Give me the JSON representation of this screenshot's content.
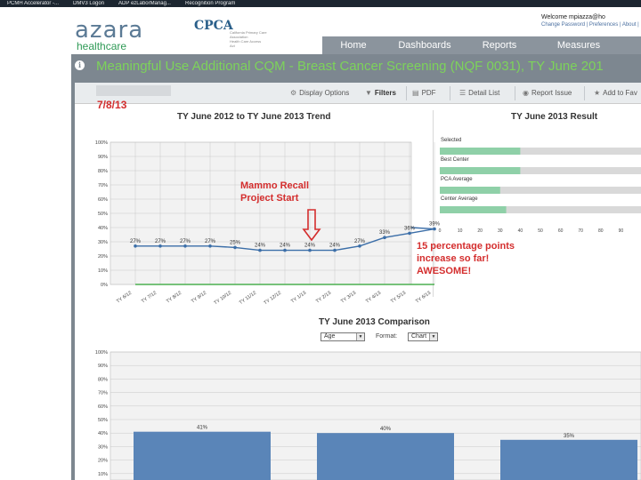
{
  "browser": {
    "tabs": [
      "PCMH Accelerator -...",
      "DMV3 Logon",
      "ADP ezLaborManag...",
      "Recognition Program"
    ]
  },
  "header": {
    "logo_main": "azara",
    "logo_sub": "healthcare",
    "partner_logo": "CPCA",
    "partner_sub": "California Primary Care Association",
    "partner_sub2": "Health Care Access Act",
    "welcome": "Welcome mpiazza@ho",
    "links": "Change Password | Preferences | About |"
  },
  "nav": {
    "items": [
      {
        "label": "Home"
      },
      {
        "label": "Dashboards"
      },
      {
        "label": "Reports"
      },
      {
        "label": "Measures"
      }
    ]
  },
  "page": {
    "title": "Meaningful Use Additional CQM - Breast Cancer Screening (NQF 0031), TY June 201"
  },
  "toolbar": {
    "display_options": "Display Options",
    "filters": "Filters",
    "pdf": "PDF",
    "detail_list": "Detail List",
    "report_issue": "Report Issue",
    "add_to_fav": "Add to Fav"
  },
  "annotations": {
    "date": "7/8/13",
    "mammo_line1": "Mammo Recall",
    "mammo_line2": "Project Start",
    "increase_line1": "15 percentage points",
    "increase_line2": "increase so far!",
    "increase_line3": "AWESOME!"
  },
  "result_panel": {
    "title": "TY June 2013 Result",
    "rows": [
      {
        "label": "Selected",
        "value": 40
      },
      {
        "label": "Best Center",
        "value": 40
      },
      {
        "label": "PCA Average",
        "value": 30
      },
      {
        "label": "Center Average",
        "value": 33
      }
    ],
    "ticks": [
      "0",
      "10",
      "20",
      "30",
      "40",
      "50",
      "60",
      "70",
      "80",
      "90"
    ],
    "colors": {
      "bar": "#8fd0a8",
      "track": "#d9d9d9"
    }
  },
  "comparison": {
    "title": "TY June 2013 Comparison",
    "group_by": "Age",
    "format_label": "Format:",
    "format_value": "Chart"
  },
  "chart_data": [
    {
      "type": "line",
      "title": "TY June 2012 to TY June 2013 Trend",
      "categories": [
        "TY 6/12",
        "TY 7/12",
        "TY 8/12",
        "TY 9/12",
        "TY 10/12",
        "TY 11/12",
        "TY 12/12",
        "TY 1/13",
        "TY 2/13",
        "TY 3/13",
        "TY 4/13",
        "TY 5/13",
        "TY 6/13"
      ],
      "series": [
        {
          "values": [
            27,
            27,
            27,
            27,
            26,
            24,
            24,
            24,
            24,
            27,
            33,
            36,
            39
          ],
          "labels": [
            "27%",
            "27%",
            "27%",
            "27%",
            "25%",
            "24%",
            "24%",
            "24%",
            "24%",
            "27%",
            "33%",
            "36%",
            "39%"
          ],
          "color": "#3b6ea8"
        },
        {
          "values": [
            0,
            0,
            0,
            0,
            0,
            0,
            0,
            0,
            0,
            0,
            0,
            0,
            0
          ],
          "color": "#4caf50"
        }
      ],
      "ylim": [
        0,
        100
      ],
      "yticks": [
        "0%",
        "10%",
        "20%",
        "30%",
        "40%",
        "50%",
        "60%",
        "70%",
        "80%",
        "90%",
        "100%"
      ],
      "grid": true
    },
    {
      "type": "bar",
      "title": "TY June 2013 Comparison",
      "categories": [
        "",
        "",
        ""
      ],
      "values": [
        41,
        40,
        35
      ],
      "labels": [
        "41%",
        "40%",
        "35%"
      ],
      "ylim": [
        0,
        100
      ],
      "yticks": [
        "0%",
        "10%",
        "20%",
        "30%",
        "40%",
        "50%",
        "60%",
        "70%",
        "80%",
        "90%",
        "100%"
      ],
      "color": "#5a85b8"
    }
  ]
}
